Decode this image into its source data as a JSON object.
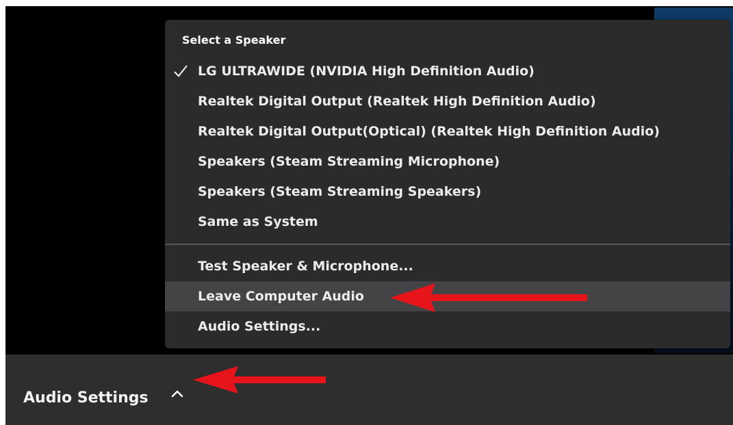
{
  "speaker_menu": {
    "heading": "Select a Speaker",
    "speakers": [
      {
        "label": "LG ULTRAWIDE (NVIDIA High Definition Audio)",
        "selected": true
      },
      {
        "label": "Realtek Digital Output (Realtek High Definition Audio)",
        "selected": false
      },
      {
        "label": "Realtek Digital Output(Optical) (Realtek High Definition Audio)",
        "selected": false
      },
      {
        "label": "Speakers (Steam Streaming Microphone)",
        "selected": false
      },
      {
        "label": "Speakers (Steam Streaming Speakers)",
        "selected": false
      },
      {
        "label": "Same as System",
        "selected": false
      }
    ],
    "actions": [
      {
        "label": "Test Speaker & Microphone..."
      },
      {
        "label": "Leave Computer Audio",
        "hovered": true
      },
      {
        "label": "Audio Settings..."
      }
    ],
    "checkmark_icon": "check-icon"
  },
  "toolbar": {
    "audio_settings_label": "Audio Settings",
    "caret_icon": "chevron-up-icon"
  },
  "colors": {
    "background": "#000000",
    "menu_bg": "#2b2b2c",
    "menu_hover": "#444446",
    "toolbar_bg": "#2e2e2f",
    "annotation_arrow": "#e8141b"
  }
}
